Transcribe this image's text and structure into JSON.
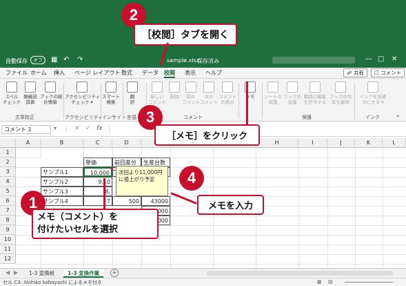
{
  "app": {
    "autosave_label": "自動保存",
    "autosave_state": "オフ",
    "file_name": "sample.xlsx",
    "save_state": "保存済み"
  },
  "callouts": {
    "step1_number": "1",
    "step1_text_line1": "メモ（コメント）を",
    "step1_text_line2": "付けたいセルを選択",
    "step2_number": "2",
    "step2_text": "［校閲］タブを開く",
    "step3_number": "3",
    "step3_text": "［メモ］をクリック",
    "step4_number": "4",
    "step4_text": "メモを入力"
  },
  "menu": {
    "items": [
      "ファイル",
      "ホーム",
      "挿入",
      "ページ レイアウト",
      "数式",
      "データ",
      "校閲",
      "表示",
      "ヘルプ"
    ],
    "share_label": "共有",
    "comment_label": "コメント"
  },
  "ribbon": {
    "groups": {
      "proofing": "文章校正",
      "accessibility": "アクセシビリティ",
      "insights": "インサイト",
      "language": "言語",
      "comments": "コメント",
      "memo": "メモ",
      "protect": "保護",
      "ink": "インク"
    },
    "buttons": {
      "spell": "スペル\nチェック",
      "thesaurus": "類義語\n辞典",
      "workbook_stats": "ブックの統\n計情報",
      "accessibility_check": "アクセシビリティ\nチェック ▾",
      "smart_lookup": "スマート\n検索",
      "translate": "翻\n訳",
      "new_comment": "新しい\nコメント",
      "delete": "削除",
      "prev_comment": "前の\nコメント",
      "next_comment": "次の\nコメント",
      "show_comments": "コメント\nの表示",
      "memo": "メモ",
      "protect_sheet": "シートの\n保護",
      "protect_workbook": "ブックの\n保護",
      "allow_edit_ranges": "範囲の編集\nを許可する",
      "unshare_workbook": "ブックの共\n有を解除",
      "hide_ink": "インクを非表\n示にする ▾"
    }
  },
  "formula_bar": {
    "name_box": "コメント 1",
    "fx": "fx"
  },
  "grid": {
    "columns": [
      "A",
      "B",
      "C",
      "D",
      "E",
      "F",
      "G",
      "H",
      "I",
      "J",
      "K",
      "L"
    ],
    "rows": [
      "1",
      "2",
      "3",
      "4",
      "5",
      "6",
      "7",
      "8",
      "9",
      "10",
      "11",
      "12"
    ],
    "header_unit_price": "単価",
    "header_diff": "前回差分",
    "header_cost": "生産台数",
    "sample1": "サンプル1",
    "sample2": "サンプル2",
    "sample3": "サンプル3",
    "sample4": "サンプル4",
    "c3": "10,000",
    "c4": "9,10",
    "c5": "8,",
    "c6": "7",
    "d6": "500",
    "e6": "43000",
    "e7": "000",
    "e8": "000"
  },
  "memo_note": {
    "text": "次回より11,000円に値上がり予定"
  },
  "sheet_tabs": {
    "tabs": [
      "1-3 変換前",
      "1-3 変換作業"
    ],
    "add": "+"
  },
  "status": {
    "text": "セル C3: Akihiko kobayashi によるメモ付き"
  }
}
